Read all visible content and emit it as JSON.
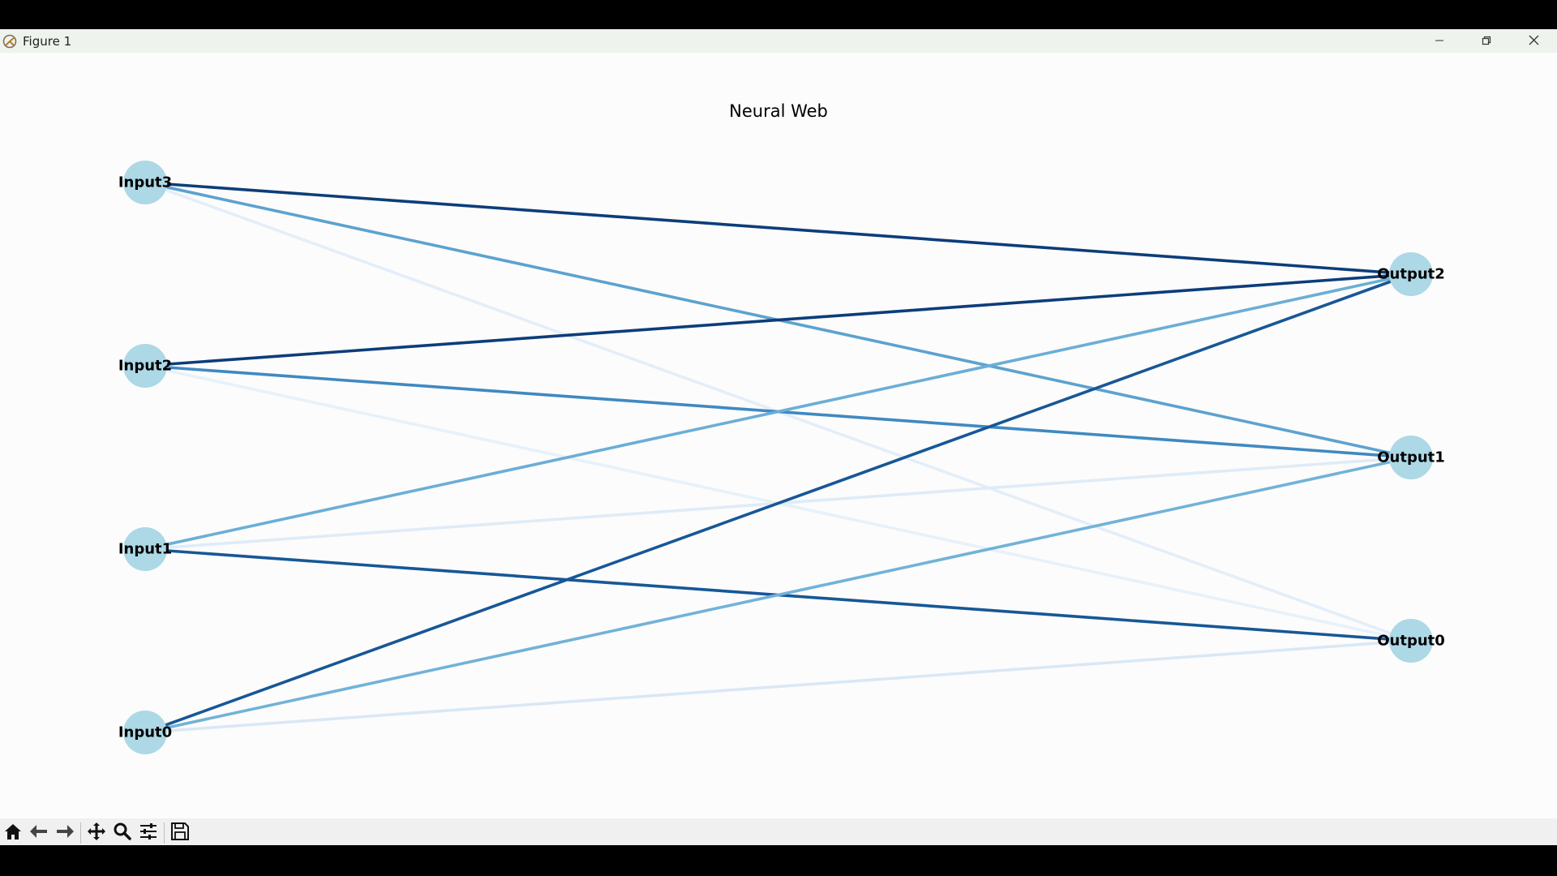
{
  "window": {
    "title": "Figure 1",
    "minimize_icon": "minimize-icon",
    "restore_icon": "restore-icon",
    "close_icon": "close-icon"
  },
  "figure": {
    "title": "Neural Web"
  },
  "nodes": [
    {
      "id": "Input3",
      "label": "Input3",
      "layer": "input",
      "row": 3
    },
    {
      "id": "Input2",
      "label": "Input2",
      "layer": "input",
      "row": 2
    },
    {
      "id": "Input1",
      "label": "Input1",
      "layer": "input",
      "row": 1
    },
    {
      "id": "Input0",
      "label": "Input0",
      "layer": "input",
      "row": 0
    },
    {
      "id": "Output2",
      "label": "Output2",
      "layer": "output",
      "row": 2
    },
    {
      "id": "Output1",
      "label": "Output1",
      "layer": "output",
      "row": 1
    },
    {
      "id": "Output0",
      "label": "Output0",
      "layer": "output",
      "row": 0
    }
  ],
  "edges": [
    {
      "from": "Input3",
      "to": "Output2",
      "weight": 0.95
    },
    {
      "from": "Input3",
      "to": "Output1",
      "weight": 0.55
    },
    {
      "from": "Input3",
      "to": "Output0",
      "weight": 0.1
    },
    {
      "from": "Input2",
      "to": "Output2",
      "weight": 0.95
    },
    {
      "from": "Input2",
      "to": "Output1",
      "weight": 0.65
    },
    {
      "from": "Input2",
      "to": "Output0",
      "weight": 0.08
    },
    {
      "from": "Input1",
      "to": "Output2",
      "weight": 0.5
    },
    {
      "from": "Input1",
      "to": "Output1",
      "weight": 0.12
    },
    {
      "from": "Input1",
      "to": "Output0",
      "weight": 0.85
    },
    {
      "from": "Input0",
      "to": "Output2",
      "weight": 0.85
    },
    {
      "from": "Input0",
      "to": "Output1",
      "weight": 0.48
    },
    {
      "from": "Input0",
      "to": "Output0",
      "weight": 0.15
    }
  ],
  "colors": {
    "node_fill": "#add8e6",
    "edge_colormap": "Blues",
    "background": "#fcfcfc"
  },
  "toolbar": {
    "icons": [
      "home-icon",
      "back-icon",
      "forward-icon",
      "pan-icon",
      "zoom-icon",
      "configure-subplots-icon",
      "save-icon"
    ]
  }
}
